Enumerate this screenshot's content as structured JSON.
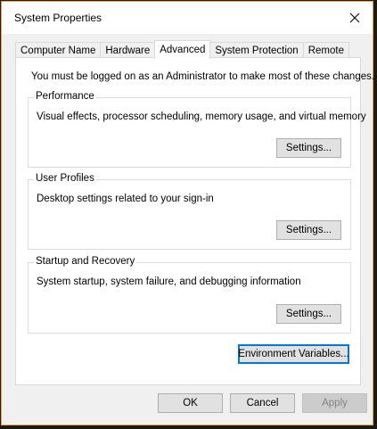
{
  "window": {
    "title": "System Properties",
    "accent_border": "#f5a623"
  },
  "icons": {
    "close": "close-icon"
  },
  "tabs": [
    {
      "label": "Computer Name",
      "active": false
    },
    {
      "label": "Hardware",
      "active": false
    },
    {
      "label": "Advanced",
      "active": true
    },
    {
      "label": "System Protection",
      "active": false
    },
    {
      "label": "Remote",
      "active": false
    }
  ],
  "advanced": {
    "admin_note": "You must be logged on as an Administrator to make most of these changes.",
    "performance": {
      "label": "Performance",
      "description": "Visual effects, processor scheduling, memory usage, and virtual memory",
      "button": "Settings..."
    },
    "user_profiles": {
      "label": "User Profiles",
      "description": "Desktop settings related to your sign-in",
      "button": "Settings..."
    },
    "startup_recovery": {
      "label": "Startup and Recovery",
      "description": "System startup, system failure, and debugging information",
      "button": "Settings..."
    },
    "env_button": "Environment Variables..."
  },
  "footer": {
    "ok": "OK",
    "cancel": "Cancel",
    "apply": "Apply"
  }
}
